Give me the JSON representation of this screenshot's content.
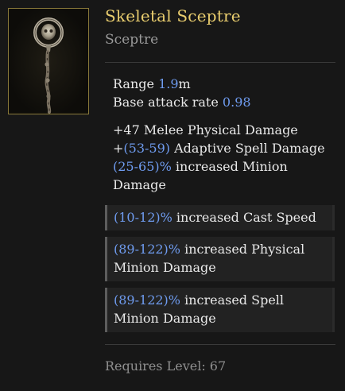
{
  "item": {
    "name": "Skeletal Sceptre",
    "type": "Sceptre",
    "icon": "skeletal-sceptre-icon"
  },
  "base_stats": {
    "range_label": "Range ",
    "range_value": "1.9",
    "range_unit": "m",
    "attack_rate_label": "Base attack rate ",
    "attack_rate_value": "0.98"
  },
  "implicit_mods": [
    {
      "value": "+47",
      "text": " Melee Physical Damage"
    },
    {
      "prefix": "+",
      "value": "(53-59)",
      "text": " Adaptive Spell Damage"
    },
    {
      "value": "(25-65)%",
      "text": " increased Minion Damage"
    }
  ],
  "affixes": [
    {
      "value": "(10-12)%",
      "text": " increased Cast Speed"
    },
    {
      "value": "(89-122)%",
      "text": " increased Physical Minion Damage"
    },
    {
      "value": "(89-122)%",
      "text": " increased Spell Minion Damage"
    }
  ],
  "requirements": {
    "text": "Requires Level: 67"
  },
  "colors": {
    "name": "#e9cd6e",
    "value": "#6f9cf0",
    "frame": "#8a7a3a"
  }
}
